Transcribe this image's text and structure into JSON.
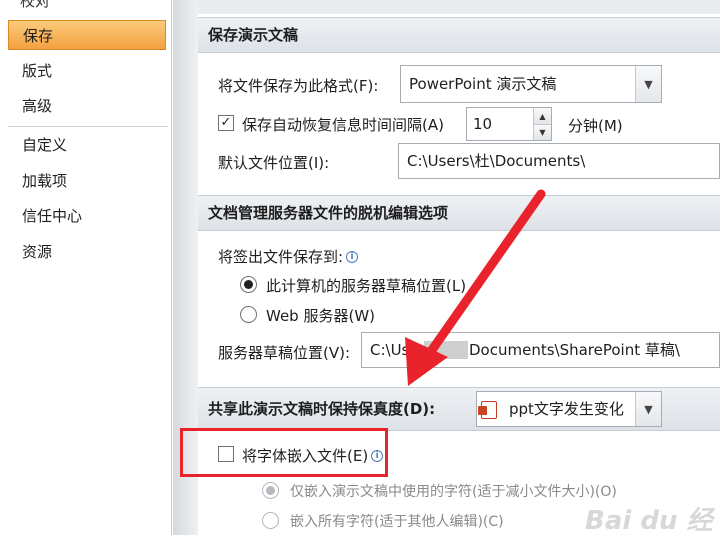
{
  "sidebar": {
    "partial_top": "校对",
    "items": [
      {
        "label": "保存",
        "active": true
      },
      {
        "label": "版式"
      },
      {
        "label": "高级"
      },
      {
        "label": "自定义"
      },
      {
        "label": "加载项"
      },
      {
        "label": "信任中心"
      },
      {
        "label": "资源"
      }
    ]
  },
  "save_section": {
    "header": "保存演示文稿",
    "format_label": "将文件保存为此格式(F):",
    "format_value": "PowerPoint 演示文稿",
    "autorecover_label": "保存自动恢复信息时间间隔(A)",
    "autorecover_checked": true,
    "autorecover_value": "10",
    "minutes_label": "分钟(M)",
    "default_location_label": "默认文件位置(I):",
    "default_location_value": "C:\\Users\\杜\\Documents\\"
  },
  "offline_section": {
    "header": "文档管理服务器文件的脱机编辑选项",
    "checkout_label": "将签出文件保存到:",
    "radio_local": "此计算机的服务器草稿位置(L)",
    "radio_web": "Web 服务器(W)",
    "drafts_label": "服务器草稿位置(V):",
    "drafts_value_left": "C:\\User",
    "drafts_value_right": "Documents\\SharePoint 草稿\\"
  },
  "fidelity_section": {
    "header": "共享此演示文稿时保持保真度(D):",
    "doc_value": "ppt文字发生变化",
    "embed_label": "将字体嵌入文件(E)",
    "embed_checked": false,
    "embed_only_used": "仅嵌入演示文稿中使用的字符(适于减小文件大小)(O)",
    "embed_all": "嵌入所有字符(适于其他人编辑)(C)"
  },
  "watermark": "Bai du 经",
  "colors": {
    "active_item": "#f3a13f",
    "highlight": "#e8232b",
    "arrow": "#e8232b"
  }
}
